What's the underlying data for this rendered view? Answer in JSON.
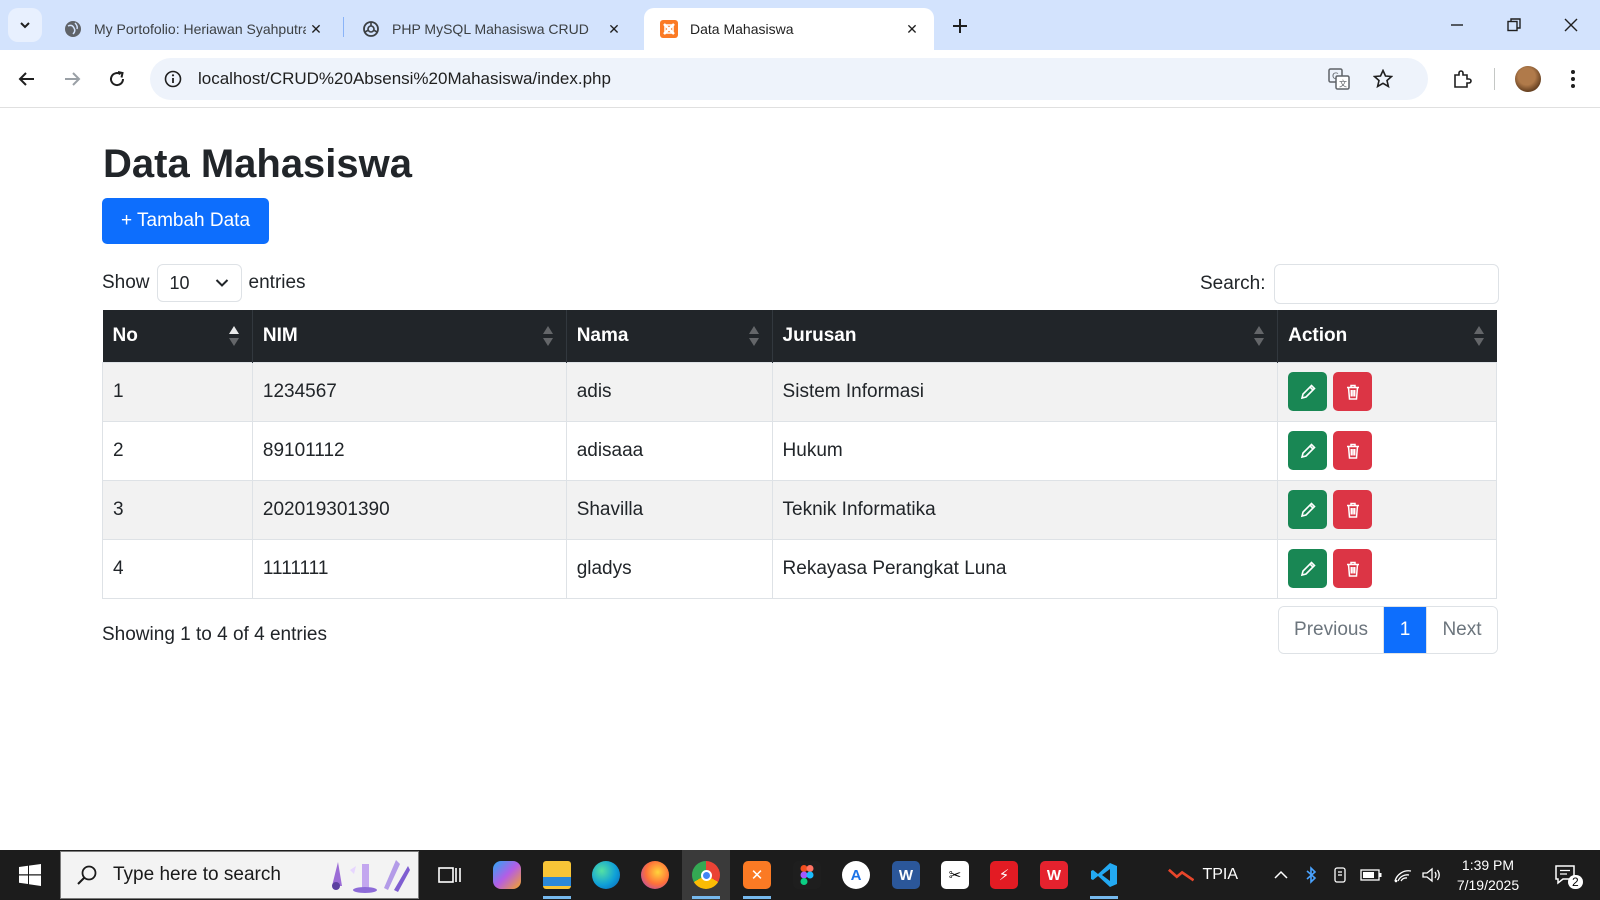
{
  "browser": {
    "tabs": [
      {
        "title": "My Portofolio: Heriawan Syahputra",
        "active": false
      },
      {
        "title": "PHP MySQL Mahasiswa CRUD",
        "active": false
      },
      {
        "title": "Data Mahasiswa",
        "active": true
      }
    ],
    "url": "localhost/CRUD%20Absensi%20Mahasiswa/index.php"
  },
  "page": {
    "title": "Data Mahasiswa",
    "add_button": "+ Tambah Data",
    "show_label": "Show",
    "entries_label": "entries",
    "page_length": "10",
    "search_label": "Search:",
    "search_value": "",
    "info": "Showing 1 to 4 of 4 entries",
    "pagination": {
      "previous": "Previous",
      "current": "1",
      "next": "Next"
    }
  },
  "table": {
    "columns": [
      "No",
      "NIM",
      "Nama",
      "Jurusan",
      "Action"
    ],
    "rows": [
      {
        "no": "1",
        "nim": "1234567",
        "nama": "adis",
        "jurusan": "Sistem Informasi"
      },
      {
        "no": "2",
        "nim": "89101112",
        "nama": "adisaaa",
        "jurusan": "Hukum"
      },
      {
        "no": "3",
        "nim": "202019301390",
        "nama": "Shavilla",
        "jurusan": "Teknik Informatika"
      },
      {
        "no": "4",
        "nim": "1111111",
        "nama": "gladys",
        "jurusan": "Rekayasa Perangkat Luna"
      }
    ]
  },
  "taskbar": {
    "search_placeholder": "Type here to search",
    "tray_label": "TPIA",
    "time": "1:39 PM",
    "date": "7/19/2025",
    "notification_count": "2"
  },
  "colors": {
    "primary": "#0d6efd",
    "success": "#198754",
    "danger": "#dc3545",
    "table_header": "#212529",
    "tabstrip": "#d3e3fd"
  }
}
